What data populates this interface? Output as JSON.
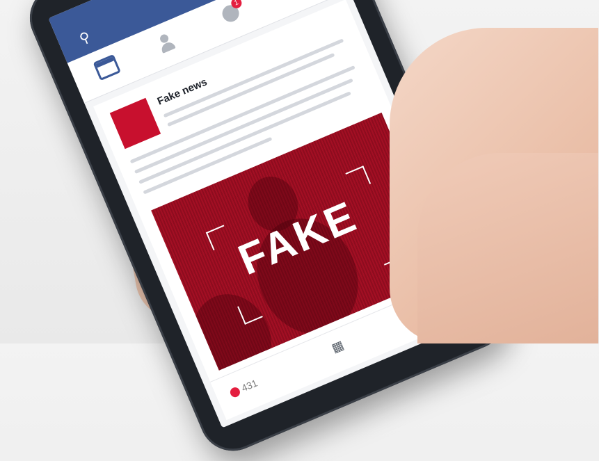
{
  "post": {
    "author": "Fake news",
    "image_text": "FAKE",
    "like_count": "431"
  },
  "notifications": {
    "badge": "1"
  },
  "colors": {
    "facebook_blue": "#3b5998",
    "fake_red": "#c8102e",
    "badge_red": "#e41e3f"
  },
  "icons": {
    "search": "search-icon",
    "friends": "friends-icon",
    "globe": "globe-icon",
    "menu": "menu-icon",
    "chevron": "chevron-down-icon",
    "newsfeed": "newsfeed-icon",
    "comment": "comment-icon",
    "share": "share-icon"
  }
}
